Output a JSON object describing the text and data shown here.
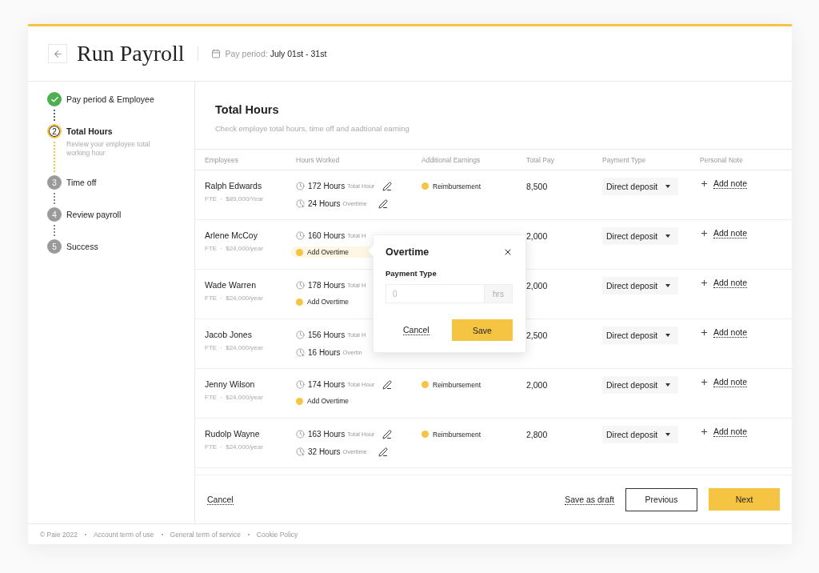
{
  "header": {
    "title": "Run Payroll",
    "period_label": "Pay period:",
    "period_value": "July 01st - 31st"
  },
  "steps": [
    {
      "label": "Pay period & Employee",
      "completed": true,
      "selected": false
    },
    {
      "number": "2",
      "label": "Total Hours",
      "description": "Review your employee total working hour",
      "completed": false,
      "selected": true
    },
    {
      "number": "3",
      "label": "Time off",
      "completed": false,
      "selected": false
    },
    {
      "number": "4",
      "label": "Review payroll",
      "completed": false,
      "selected": false
    },
    {
      "number": "5",
      "label": "Success",
      "completed": false,
      "selected": false
    }
  ],
  "section": {
    "title": "Total Hours",
    "subtitle": "Check employe total hours, time off and aadtional earning"
  },
  "table": {
    "columns": [
      "Employees",
      "Hours Worked",
      "Additional Earnings",
      "Total Pay",
      "Payment Type",
      "Personal Note"
    ],
    "rows": [
      {
        "name": "Ralph Edwards",
        "meta": "FTE · $89,000/Year",
        "hours": [
          {
            "kind": "total",
            "value": "172 Hours",
            "label": "Total Hour",
            "editable": true
          },
          {
            "kind": "overtime",
            "value": "24 Hours",
            "label": "Overtime",
            "editable": true
          }
        ],
        "earning": "Reimbursement",
        "total_pay": "8,500",
        "payment_type": "Direct deposit",
        "note": "Add note"
      },
      {
        "name": "Arlene McCoy",
        "meta": "FTE · $24,000/year",
        "hours": [
          {
            "kind": "total",
            "value": "160 Hours",
            "label": "Total H",
            "editable": false
          },
          {
            "kind": "add",
            "label": "Add Overtime",
            "active": true
          }
        ],
        "total_pay": "2,000",
        "payment_type": "Direct deposit",
        "note": "Add note"
      },
      {
        "name": "Wade Warren",
        "meta": "FTE · $24,000/year",
        "hours": [
          {
            "kind": "total",
            "value": "178 Hours",
            "label": "Total H",
            "editable": false
          },
          {
            "kind": "add",
            "label": "Add Overtime",
            "active": false
          }
        ],
        "total_pay": "2,000",
        "payment_type": "Direct deposit",
        "note": "Add note"
      },
      {
        "name": "Jacob Jones",
        "meta": "FTE · $24,000/year",
        "hours": [
          {
            "kind": "total",
            "value": "156 Hours",
            "label": "Total H",
            "editable": false
          },
          {
            "kind": "overtime",
            "value": "16 Hours",
            "label": "Overtin",
            "editable": false
          }
        ],
        "total_pay": "2,500",
        "payment_type": "Direct deposit",
        "note": "Add note"
      },
      {
        "name": "Jenny Wilson",
        "meta": "FTE · $24,000/year",
        "hours": [
          {
            "kind": "total",
            "value": "174 Hours",
            "label": "Total Hour",
            "editable": true
          },
          {
            "kind": "add",
            "label": "Add Overtime",
            "active": false
          }
        ],
        "earning": "Reimbursement",
        "total_pay": "2,000",
        "payment_type": "Direct deposit",
        "note": "Add note"
      },
      {
        "name": "Rudolp Wayne",
        "meta": "FTE · $24,000/year",
        "hours": [
          {
            "kind": "total",
            "value": "163 Hours",
            "label": "Total Hour",
            "editable": true
          },
          {
            "kind": "overtime",
            "value": "32 Hours",
            "label": "Overtime",
            "editable": true
          }
        ],
        "earning": "Reimbursement",
        "total_pay": "2,800",
        "payment_type": "Direct deposit",
        "note": "Add note"
      }
    ]
  },
  "popover": {
    "title": "Overtime",
    "field_label": "Payment Type",
    "placeholder": "0",
    "unit": "hrs",
    "cancel": "Cancel",
    "save": "Save"
  },
  "actions": {
    "cancel": "Cancel",
    "draft": "Save as draft",
    "previous": "Previous",
    "next": "Next"
  },
  "footer": [
    "© Paie 2022",
    "Account term of use",
    "General term of service",
    "Cookie Policy"
  ]
}
